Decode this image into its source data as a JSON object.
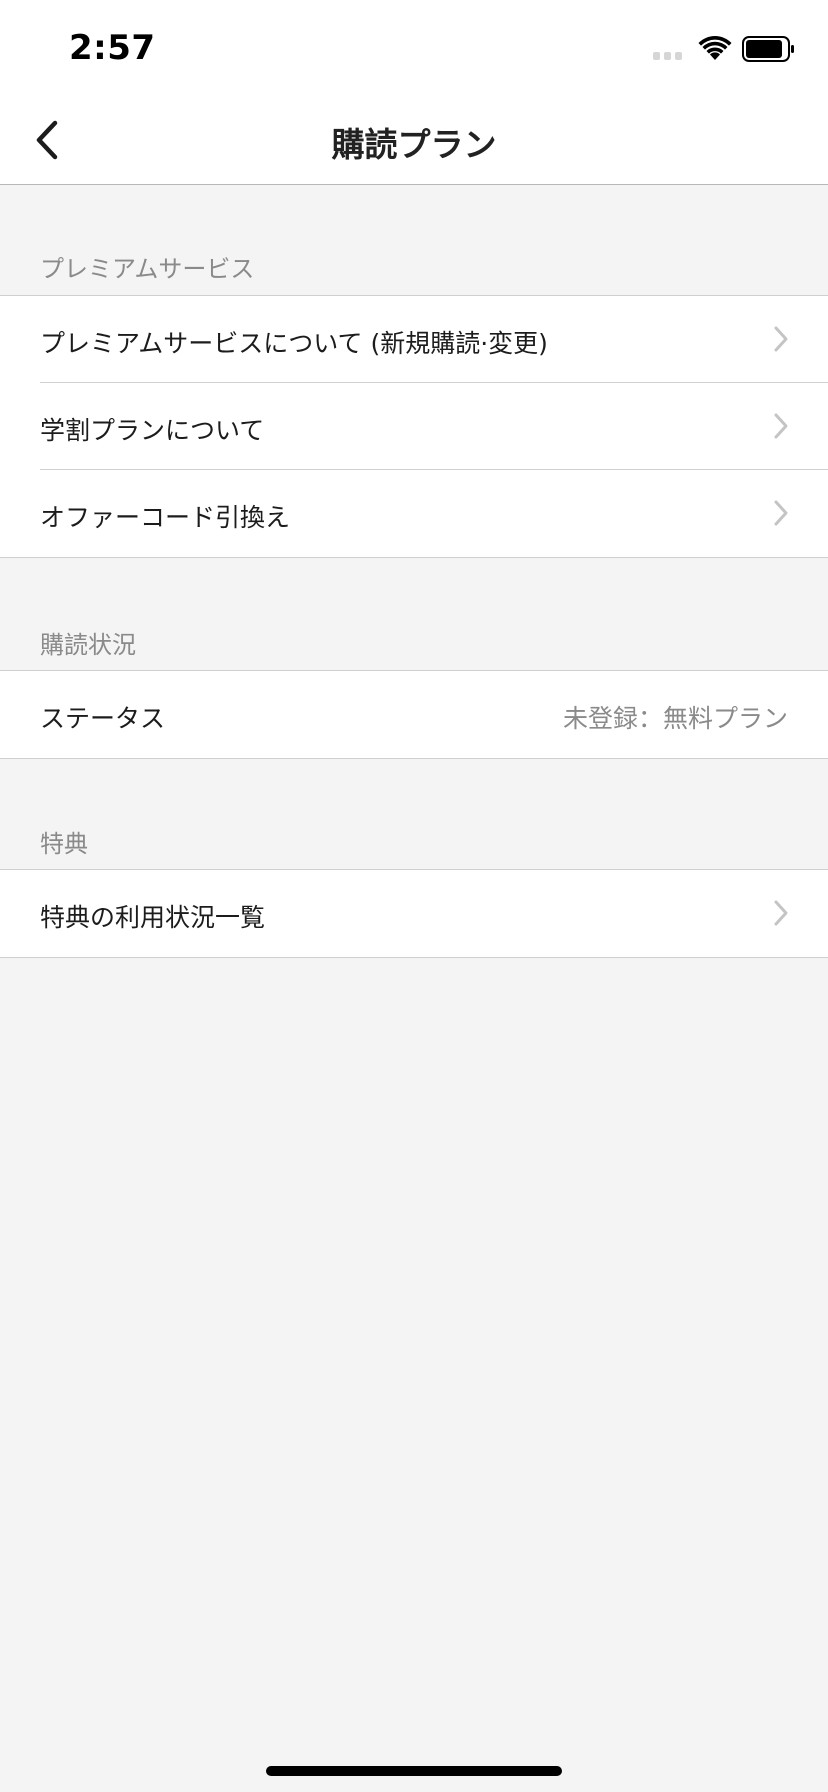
{
  "status_bar": {
    "time": "2:57",
    "icons": [
      "cellular-signal-icon",
      "wifi-icon",
      "battery-icon"
    ]
  },
  "nav": {
    "title": "購読プラン",
    "back_icon": "chevron-left-icon"
  },
  "sections": [
    {
      "header": "プレミアムサービス",
      "rows": [
        {
          "label": "プレミアムサービスについて (新規購読·変更)",
          "icon": "chevron-right-icon"
        },
        {
          "label": "学割プランについて",
          "icon": "chevron-right-icon"
        },
        {
          "label": "オファーコード引換え",
          "icon": "chevron-right-icon"
        }
      ]
    },
    {
      "header": "購読状況",
      "rows": [
        {
          "label": "ステータス",
          "value": "未登録：無料プラン"
        }
      ]
    },
    {
      "header": "特典",
      "rows": [
        {
          "label": "特典の利用状況一覧",
          "icon": "chevron-right-icon"
        }
      ]
    }
  ],
  "colors": {
    "background": "#f4f4f4",
    "cell_background": "#ffffff",
    "section_header_text": "#8a8a8a",
    "chevron": "#c4c4c4",
    "separator": "#cfcfcf"
  }
}
